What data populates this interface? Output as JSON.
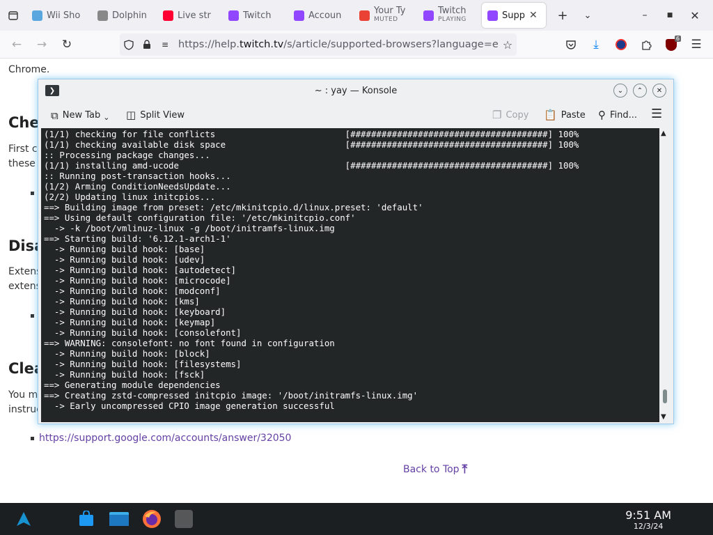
{
  "browser": {
    "tabs": [
      {
        "title": "Wii Sho",
        "icon": "wii-shop-icon",
        "color": "#5aa7e0"
      },
      {
        "title": "Dolphin",
        "icon": "dolphin-icon",
        "color": "#888"
      },
      {
        "title": "Live str",
        "icon": "youtube-icon",
        "color": "#ff0033"
      },
      {
        "title": "Twitch",
        "icon": "twitch-icon",
        "color": "#9146ff"
      },
      {
        "title": "Accoun",
        "icon": "twitch-icon",
        "color": "#9146ff"
      },
      {
        "title": "Your Ty",
        "subtitle": "MUTED",
        "icon": "gmail-icon",
        "color": "#ea4335"
      },
      {
        "title": "Twitch",
        "subtitle": "PLAYING",
        "icon": "twitch-icon",
        "color": "#9146ff"
      },
      {
        "title": "Supp",
        "icon": "twitch-icon",
        "color": "#9146ff",
        "active": true
      }
    ],
    "url_prefix": "https://help.",
    "url_domain": "twitch.tv",
    "url_suffix": "/s/article/supported-browsers?language=en_US",
    "extension_badge": "6"
  },
  "page": {
    "line_chrome": "Chrome.",
    "heading1": "Che",
    "p1_line1": "First cl",
    "p1_line2": "these i",
    "heading2": "Disa",
    "p2_line1": "Extens",
    "p2_line2": "extens",
    "heading3": "Clea",
    "p3_line1": "You ma",
    "p3_line2": "instruc",
    "link": "https://support.google.com/accounts/answer/32050",
    "back_to_top": "Back to Top"
  },
  "konsole": {
    "title": "~ : yay — Konsole",
    "new_tab": "New Tab",
    "split_view": "Split View",
    "copy": "Copy",
    "paste": "Paste",
    "find": "Find...",
    "lines": [
      "(1/1) checking for file conflicts                         [######################################] 100%",
      "(1/1) checking available disk space                       [######################################] 100%",
      ":: Processing package changes...",
      "(1/1) installing amd-ucode                                [######################################] 100%",
      ":: Running post-transaction hooks...",
      "(1/2) Arming ConditionNeedsUpdate...",
      "(2/2) Updating linux initcpios...",
      "==> Building image from preset: /etc/mkinitcpio.d/linux.preset: 'default'",
      "==> Using default configuration file: '/etc/mkinitcpio.conf'",
      "  -> -k /boot/vmlinuz-linux -g /boot/initramfs-linux.img",
      "==> Starting build: '6.12.1-arch1-1'",
      "  -> Running build hook: [base]",
      "  -> Running build hook: [udev]",
      "  -> Running build hook: [autodetect]",
      "  -> Running build hook: [microcode]",
      "  -> Running build hook: [modconf]",
      "  -> Running build hook: [kms]",
      "  -> Running build hook: [keyboard]",
      "  -> Running build hook: [keymap]",
      "  -> Running build hook: [consolefont]",
      "==> WARNING: consolefont: no font found in configuration",
      "  -> Running build hook: [block]",
      "  -> Running build hook: [filesystems]",
      "  -> Running build hook: [fsck]",
      "==> Generating module dependencies",
      "==> Creating zstd-compressed initcpio image: '/boot/initramfs-linux.img'",
      "  -> Early uncompressed CPIO image generation successful"
    ]
  },
  "taskbar": {
    "time": "9:51 AM",
    "date": "12/3/24"
  }
}
